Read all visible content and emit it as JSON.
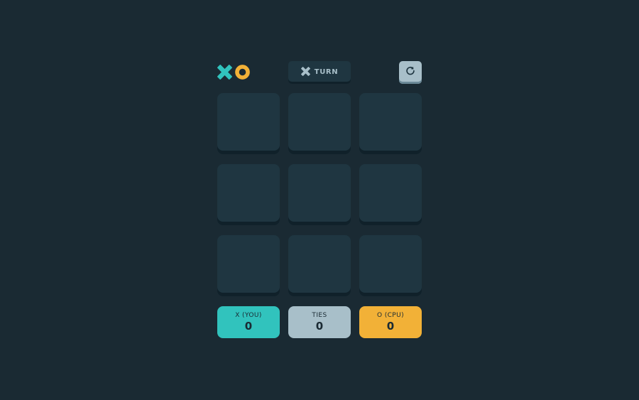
{
  "colors": {
    "background": "#1a2a33",
    "cell": "#1f3641",
    "x_color": "#31c3bd",
    "o_color": "#f2b137",
    "silver": "#a8bfc9"
  },
  "header": {
    "logo_x_icon": "x-mark-icon",
    "logo_o_icon": "o-mark-icon",
    "turn_icon": "x-mark-icon",
    "turn_label": "TURN",
    "restart_icon": "restart-icon"
  },
  "board": {
    "cells": [
      "",
      "",
      "",
      "",
      "",
      "",
      "",
      "",
      ""
    ]
  },
  "scores": {
    "x": {
      "label": "X (YOU)",
      "value": "0"
    },
    "ties": {
      "label": "TIES",
      "value": "0"
    },
    "o": {
      "label": "O (CPU)",
      "value": "0"
    }
  }
}
